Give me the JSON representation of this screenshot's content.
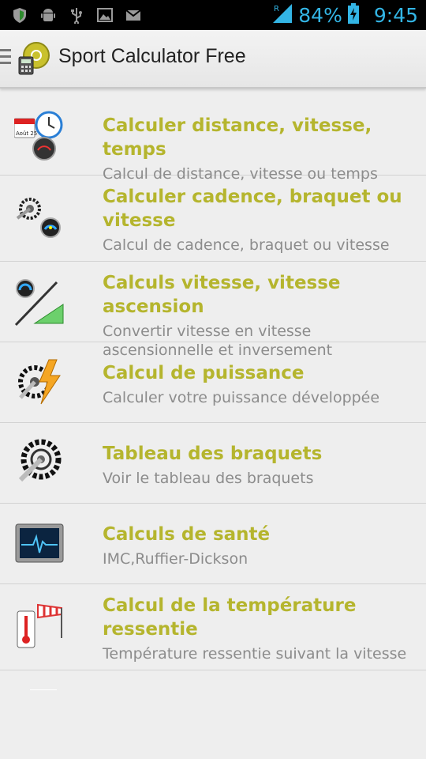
{
  "status_bar": {
    "battery_pct": "84%",
    "time": "9:45",
    "icons": [
      "shield-icon",
      "android-icon",
      "usb-icon",
      "image-icon",
      "gmail-icon",
      "signal-icon",
      "battery-charging-icon"
    ]
  },
  "action_bar": {
    "title": "Sport Calculator Free"
  },
  "list": {
    "items": [
      {
        "title": "Calculer distance, vitesse, temps",
        "subtitle": "Calcul de distance, vitesse ou temps",
        "icon": "calendar-clock-speedometer-icon",
        "calendar_text": "Août 25"
      },
      {
        "title": "Calculer cadence, braquet ou vitesse",
        "subtitle": "Calcul de cadence, braquet ou vitesse",
        "icon": "crankset-speedometer-icon"
      },
      {
        "title": "Calculs vitesse, vitesse ascension",
        "subtitle": "Convertir vitesse en vitesse ascensionnelle et inversement",
        "icon": "speed-slope-icon"
      },
      {
        "title": "Calcul de puissance",
        "subtitle": "Calculer votre puissance développée",
        "icon": "crankset-lightning-icon"
      },
      {
        "title": "Tableau des braquets",
        "subtitle": "Voir le tableau des braquets",
        "icon": "crankset-icon"
      },
      {
        "title": "Calculs de santé",
        "subtitle": "IMC,Ruffier-Dickson",
        "icon": "heart-monitor-icon"
      },
      {
        "title": "Calcul de la température ressentie",
        "subtitle": "Température ressentie suivant la vitesse",
        "icon": "thermometer-windsock-icon"
      }
    ]
  }
}
